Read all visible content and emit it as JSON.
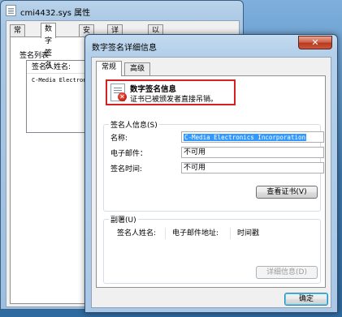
{
  "back_window": {
    "title": "cmi4432.sys 属性",
    "tabs": [
      "常规",
      "数字签名",
      "安全",
      "详细信息",
      "以前的版本"
    ],
    "active_tab": "数字签名",
    "signature_list_label": "签名列表",
    "list_header": "签名人姓名:",
    "list_row": "C-Media Electronics"
  },
  "dialog": {
    "title": "数字签名详细信息",
    "close_glyph": "✕",
    "tabs": [
      "常规",
      "高级"
    ],
    "active_tab": "常规",
    "warning": {
      "title": "数字签名信息",
      "message": "证书已被颁发者直接吊销。",
      "icon": "certificate-error-icon"
    },
    "signer_info": {
      "label": "签名人信息(S)",
      "name_label": "名称:",
      "name_value": "C-Media Electronics Incorporation",
      "email_label": "电子邮件：",
      "email_value": "不可用",
      "time_label": "签名时间:",
      "time_value": "不可用",
      "view_cert_button": "查看证书(V)"
    },
    "countersignatures": {
      "label": "副署(U)",
      "columns": [
        "签名人姓名:",
        "电子邮件地址:",
        "时间戳"
      ],
      "details_button": "详细信息(D)"
    },
    "ok_button": "确定"
  },
  "colors": {
    "warning_border": "#d42121",
    "selection": "#3399ff"
  }
}
